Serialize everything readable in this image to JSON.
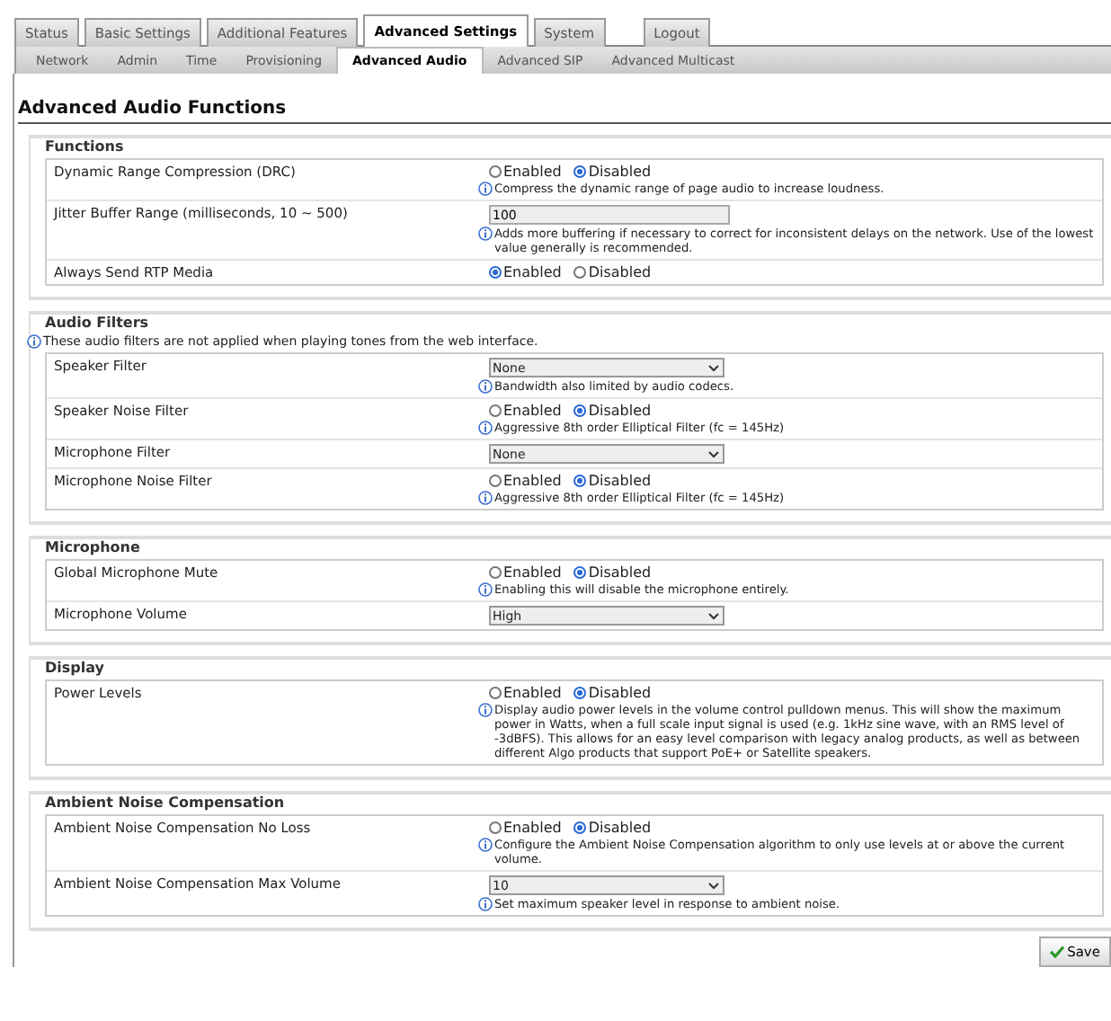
{
  "main_tabs": [
    {
      "label": "Status",
      "selected": false
    },
    {
      "label": "Basic Settings",
      "selected": false
    },
    {
      "label": "Additional Features",
      "selected": false
    },
    {
      "label": "Advanced Settings",
      "selected": true
    },
    {
      "label": "System",
      "selected": false
    },
    {
      "label": "Logout",
      "selected": false
    }
  ],
  "sub_tabs": [
    {
      "label": "Network",
      "selected": false
    },
    {
      "label": "Admin",
      "selected": false
    },
    {
      "label": "Time",
      "selected": false
    },
    {
      "label": "Provisioning",
      "selected": false
    },
    {
      "label": "Advanced Audio",
      "selected": true
    },
    {
      "label": "Advanced SIP",
      "selected": false
    },
    {
      "label": "Advanced Multicast",
      "selected": false
    }
  ],
  "page_title": "Advanced Audio Functions",
  "sections": [
    {
      "title": "Functions",
      "rows": [
        {
          "label": "Dynamic Range Compression (DRC)",
          "kind": "radio",
          "options": [
            {
              "label": "Enabled",
              "selected": false
            },
            {
              "label": "Disabled",
              "selected": true
            }
          ],
          "hint": "Compress the dynamic range of page audio to increase loudness."
        },
        {
          "label": "Jitter Buffer Range (milliseconds, 10 ~ 500)",
          "kind": "text",
          "value": "100",
          "hint": "Adds more buffering if necessary to correct for inconsistent delays on the network. Use of the lowest value generally is recommended."
        },
        {
          "label": "Always Send RTP Media",
          "kind": "radio",
          "options": [
            {
              "label": "Enabled",
              "selected": true
            },
            {
              "label": "Disabled",
              "selected": false
            }
          ]
        }
      ]
    },
    {
      "title": "Audio Filters",
      "note": "These audio filters are not applied when playing tones from the web interface.",
      "rows": [
        {
          "label": "Speaker Filter",
          "kind": "select",
          "value": "None",
          "hint": "Bandwidth also limited by audio codecs."
        },
        {
          "label": "Speaker Noise Filter",
          "kind": "radio",
          "options": [
            {
              "label": "Enabled",
              "selected": false
            },
            {
              "label": "Disabled",
              "selected": true
            }
          ],
          "hint": "Aggressive 8th order Elliptical Filter (fc = 145Hz)"
        },
        {
          "label": "Microphone Filter",
          "kind": "select",
          "value": "None"
        },
        {
          "label": "Microphone Noise Filter",
          "kind": "radio",
          "options": [
            {
              "label": "Enabled",
              "selected": false
            },
            {
              "label": "Disabled",
              "selected": true
            }
          ],
          "hint": "Aggressive 8th order Elliptical Filter (fc = 145Hz)"
        }
      ]
    },
    {
      "title": "Microphone",
      "rows": [
        {
          "label": "Global Microphone Mute",
          "kind": "radio",
          "options": [
            {
              "label": "Enabled",
              "selected": false
            },
            {
              "label": "Disabled",
              "selected": true
            }
          ],
          "hint": "Enabling this will disable the microphone entirely."
        },
        {
          "label": "Microphone Volume",
          "kind": "select",
          "value": "High"
        }
      ]
    },
    {
      "title": "Display",
      "rows": [
        {
          "label": "Power Levels",
          "kind": "radio",
          "options": [
            {
              "label": "Enabled",
              "selected": false
            },
            {
              "label": "Disabled",
              "selected": true
            }
          ],
          "hint": "Display audio power levels in the volume control pulldown menus. This will show the maximum power in Watts, when a full scale input signal is used (e.g. 1kHz sine wave, with an RMS level of -3dBFS). This allows for an easy level comparison with legacy analog products, as well as between different Algo products that support PoE+ or Satellite speakers."
        }
      ]
    },
    {
      "title": "Ambient Noise Compensation",
      "rows": [
        {
          "label": "Ambient Noise Compensation No Loss",
          "kind": "radio",
          "options": [
            {
              "label": "Enabled",
              "selected": false
            },
            {
              "label": "Disabled",
              "selected": true
            }
          ],
          "hint": "Configure the Ambient Noise Compensation algorithm to only use levels at or above the current volume."
        },
        {
          "label": "Ambient Noise Compensation Max Volume",
          "kind": "select",
          "value": "10",
          "hint": "Set maximum speaker level in response to ambient noise."
        }
      ]
    }
  ],
  "save_button": "Save"
}
